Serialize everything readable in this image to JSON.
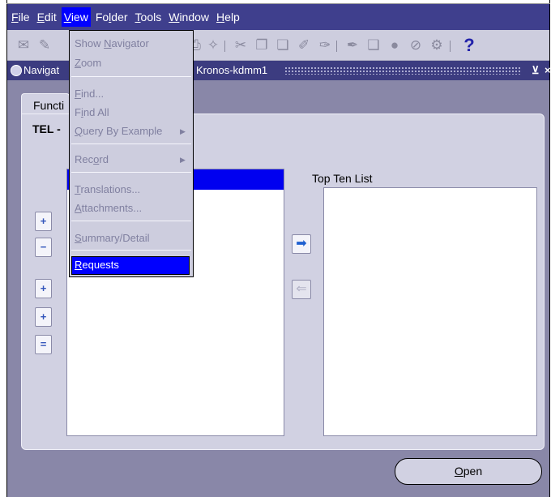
{
  "menubar": {
    "items": [
      {
        "label_prefix": "",
        "mnemonic": "F",
        "label_rest": "ile"
      },
      {
        "label_prefix": "",
        "mnemonic": "E",
        "label_rest": "dit"
      },
      {
        "label_prefix": "",
        "mnemonic": "V",
        "label_rest": "iew"
      },
      {
        "label_prefix": "Fo",
        "mnemonic": "l",
        "label_rest": "der"
      },
      {
        "label_prefix": "",
        "mnemonic": "T",
        "label_rest": "ools"
      },
      {
        "label_prefix": "",
        "mnemonic": "W",
        "label_rest": "indow"
      },
      {
        "label_prefix": "",
        "mnemonic": "H",
        "label_rest": "elp"
      }
    ],
    "active_index": 2
  },
  "toolbar": {
    "icons": [
      "new-icon",
      "find-icon",
      "print-icon",
      "paste-icon",
      "cut-icon",
      "copy-icon",
      "clear-icon",
      "delete-icon",
      "edit-icon",
      "folder-icon",
      "zoom-icon",
      "attachments-icon",
      "translations-icon",
      "help-icon"
    ],
    "help_label": "?"
  },
  "navigator_window": {
    "title_left": "Navigat",
    "title_right": "Kronos-kdmm1",
    "minimize_label": "⊻",
    "close_label": "×"
  },
  "panel": {
    "tab_label": "Functi",
    "title": "TEL -",
    "top_ten_label": "Top Ten List"
  },
  "side_buttons": {
    "expand": "+",
    "collapse": "−",
    "expand_branch": "+",
    "expand_all": "+",
    "collapse_all": "="
  },
  "arrows": {
    "right": "➡",
    "left": "⇐"
  },
  "open_button": {
    "mnemonic": "O",
    "rest": "pen"
  },
  "view_menu": {
    "items": [
      {
        "prefix": "Show ",
        "mnemonic": "N",
        "rest": "avigator",
        "enabled": false
      },
      {
        "prefix": "",
        "mnemonic": "Z",
        "rest": "oom",
        "enabled": false
      },
      {
        "prefix": "",
        "mnemonic": "F",
        "rest": "ind...",
        "enabled": false
      },
      {
        "prefix": "F",
        "mnemonic": "i",
        "rest": "nd All",
        "enabled": false
      },
      {
        "prefix": "",
        "mnemonic": "Q",
        "rest": "uery By Example",
        "enabled": false
      },
      {
        "prefix": "Rec",
        "mnemonic": "o",
        "rest": "rd",
        "enabled": false
      },
      {
        "prefix": "",
        "mnemonic": "T",
        "rest": "ranslations...",
        "enabled": false
      },
      {
        "prefix": "",
        "mnemonic": "A",
        "rest": "ttachments...",
        "enabled": false
      },
      {
        "prefix": "",
        "mnemonic": "S",
        "rest": "ummary/Detail",
        "enabled": false
      },
      {
        "prefix": "",
        "mnemonic": "R",
        "rest": "equests",
        "enabled": true
      }
    ],
    "submenu_arrow": "▶"
  }
}
